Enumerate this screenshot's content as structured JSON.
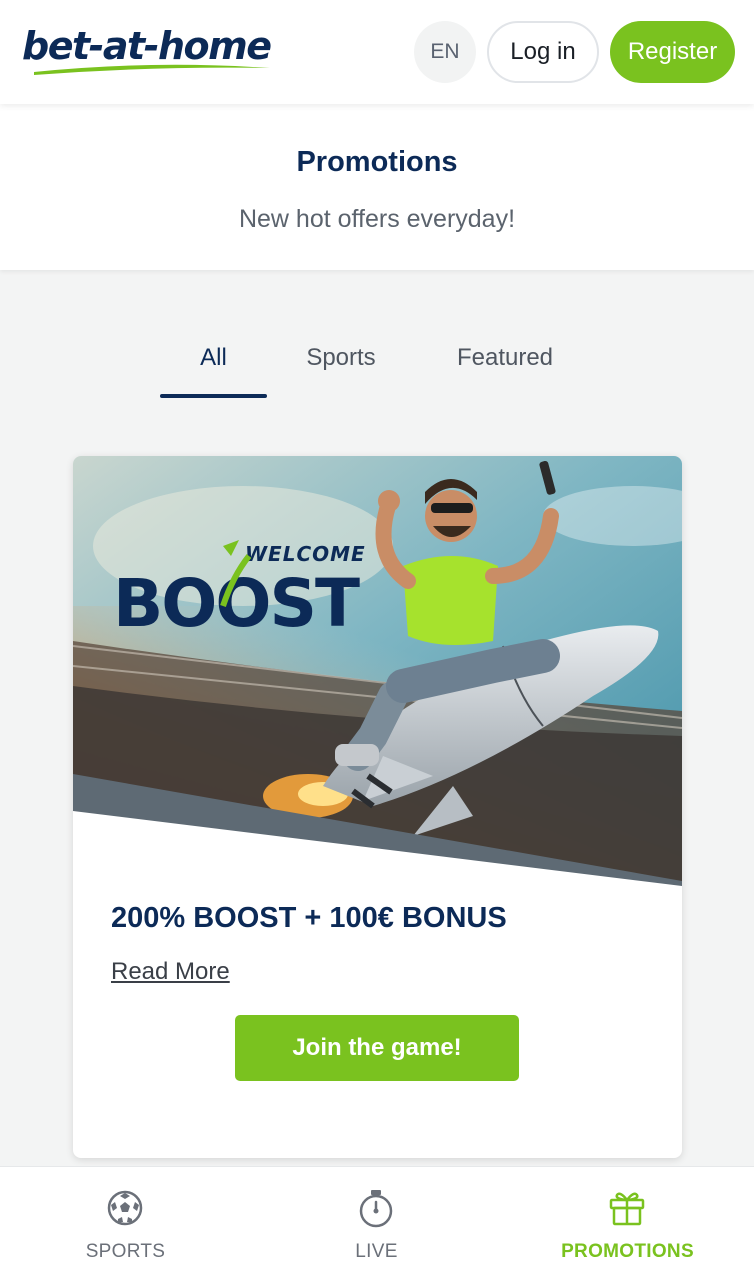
{
  "header": {
    "logo_text": "bet-at-home",
    "language": "EN",
    "login_label": "Log in",
    "register_label": "Register"
  },
  "promotions": {
    "title": "Promotions",
    "subtitle": "New hot offers everyday!"
  },
  "tabs": [
    {
      "label": "All",
      "active": true
    },
    {
      "label": "Sports",
      "active": false
    },
    {
      "label": "Featured",
      "active": false
    }
  ],
  "card": {
    "banner": {
      "welcome_text": "WELCOME",
      "boost_text": "BOOST"
    },
    "title": "200% BOOST + 100€ BONUS",
    "read_more": "Read More",
    "cta": "Join the game!"
  },
  "bottom_nav": [
    {
      "label": "SPORTS",
      "icon": "soccer-ball-icon",
      "active": false
    },
    {
      "label": "LIVE",
      "icon": "stopwatch-icon",
      "active": false
    },
    {
      "label": "PROMOTIONS",
      "icon": "gift-icon",
      "active": true
    }
  ],
  "colors": {
    "brand_navy": "#0c2a57",
    "brand_green": "#7ac21f",
    "page_bg": "#f3f4f4"
  }
}
